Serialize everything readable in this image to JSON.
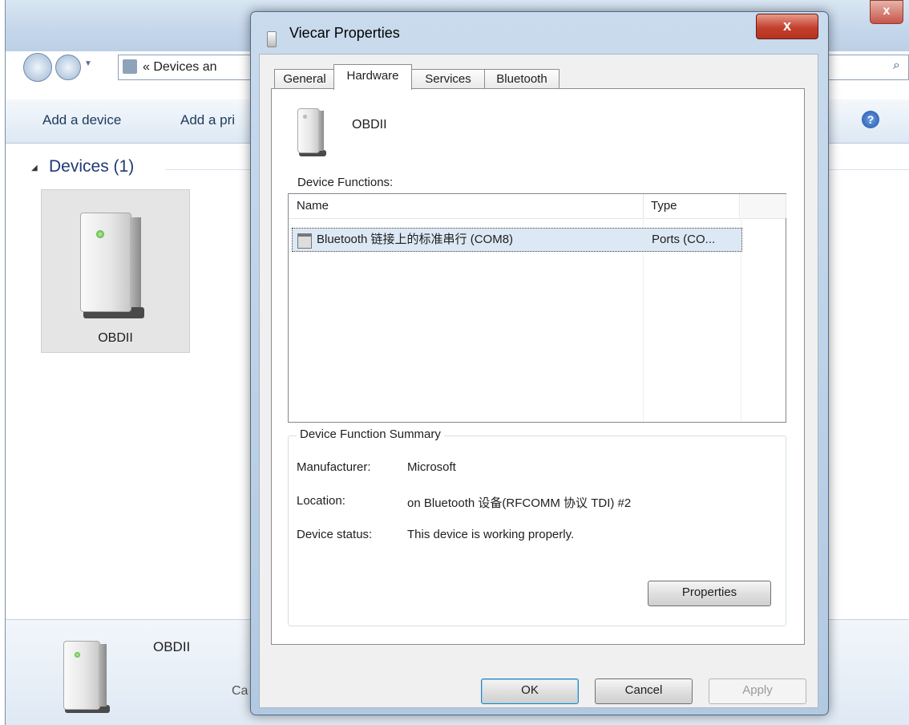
{
  "explorer": {
    "address": "« Devices an",
    "toolbar": {
      "add_device": "Add a device",
      "add_printer": "Add a pri"
    },
    "group_title": "Devices (1)",
    "device_tile_label": "OBDII",
    "details_name": "OBDII",
    "details_category": "Ca",
    "help_glyph": "?",
    "close_glyph": "x",
    "search_glyph": "⌕"
  },
  "dialog": {
    "title": "Viecar Properties",
    "close_glyph": "x",
    "tabs": [
      {
        "label": "General"
      },
      {
        "label": "Hardware"
      },
      {
        "label": "Services"
      },
      {
        "label": "Bluetooth"
      }
    ],
    "active_tab": "Hardware",
    "device_name": "OBDII",
    "functions_label": "Device Functions:",
    "columns": {
      "name": "Name",
      "type": "Type"
    },
    "rows": [
      {
        "name": "Bluetooth 链接上的标准串行 (COM8)",
        "type": "Ports (CO..."
      }
    ],
    "summary": {
      "title": "Device Function Summary",
      "manufacturer_label": "Manufacturer:",
      "manufacturer": "Microsoft",
      "location_label": "Location:",
      "location": "on Bluetooth 设备(RFCOMM 协议 TDI) #2",
      "status_label": "Device status:",
      "status": "This device is working properly."
    },
    "properties_button": "Properties",
    "ok_button": "OK",
    "cancel_button": "Cancel",
    "apply_button": "Apply"
  }
}
